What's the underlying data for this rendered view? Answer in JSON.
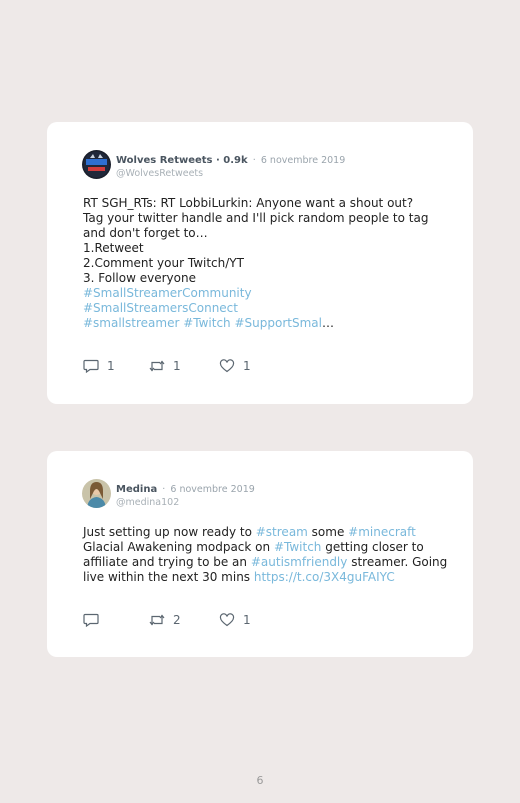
{
  "tweets": [
    {
      "name": "Wolves Retweets · 0.9k",
      "separator": "·",
      "date": "6 novembre 2019",
      "handle": "@WolvesRetweets",
      "lines": [
        "RT SGH_RTs: RT LobbiLurkin: Anyone want a shout out?",
        "Tag your twitter handle and I'll pick random people to tag",
        "and don't forget to…",
        "1.Retweet",
        "2.Comment your Twitch/YT",
        "3. Follow everyone",
        "#SmallStreamerCommunity",
        "#SmallStreamersConnect",
        "#smallstreamer #Twitch #SupportSmal",
        "…"
      ],
      "replies": "1",
      "retweets": "1",
      "likes": "1"
    },
    {
      "name": "Medina",
      "separator": "·",
      "date": "6 novembre 2019",
      "handle": "@medina102",
      "t1a": "Just setting up now ready to ",
      "t1b": "#stream",
      "t1c": " some ",
      "t1d": "#minecraft",
      "t2a": "Glacial Awakening modpack on ",
      "t2b": "#Twitch",
      "t2c": " getting closer to",
      "t3a": "affiliate and trying to be an ",
      "t3b": "#autismfriendly",
      "t3c": " streamer. Going",
      "t4a": "live within the next 30 mins ",
      "t4b": "https://t.co/3X4guFAIYC",
      "replies": "",
      "retweets": "2",
      "likes": "1"
    }
  ],
  "page_number": "6",
  "colors": {
    "background": "#eee9e8",
    "card": "#ffffff",
    "hashtag": "#79b8db",
    "meta": "#9aa4ac"
  },
  "icons": [
    "reply-icon",
    "retweet-icon",
    "heart-icon"
  ]
}
